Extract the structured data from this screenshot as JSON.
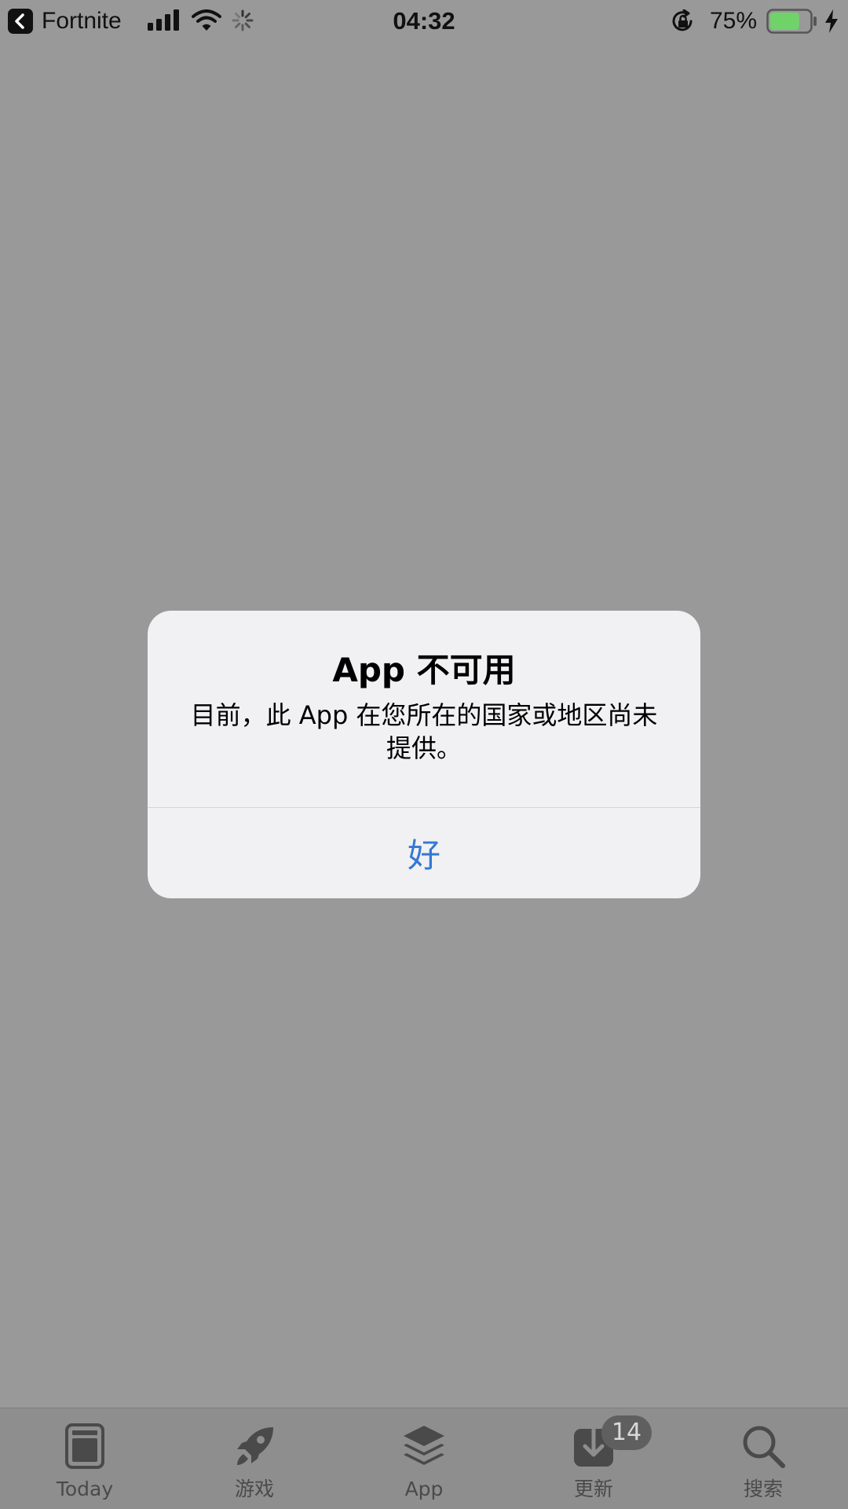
{
  "status_bar": {
    "back_app_label": "Fortnite",
    "time": "04:32",
    "battery_percent_text": "75%",
    "battery_level": 0.75,
    "battery_fill_color": "#6fd36a",
    "icons": [
      "back-arrow-icon",
      "cellular-signal-icon",
      "wifi-icon",
      "activity-spinner-icon",
      "rotation-lock-icon",
      "battery-icon",
      "charging-bolt-icon"
    ]
  },
  "alert": {
    "title": "App 不可用",
    "message": "目前，此 App 在您所在的国家或地区尚未提供。",
    "ok_button": "好",
    "ok_color": "#3478d4"
  },
  "tab_bar": {
    "tabs": [
      {
        "label": "Today",
        "icon": "today-icon"
      },
      {
        "label": "游戏",
        "icon": "rocket-icon"
      },
      {
        "label": "App",
        "icon": "app-stack-icon"
      },
      {
        "label": "更新",
        "icon": "download-icon",
        "badge": "14"
      },
      {
        "label": "搜索",
        "icon": "search-icon"
      }
    ]
  }
}
